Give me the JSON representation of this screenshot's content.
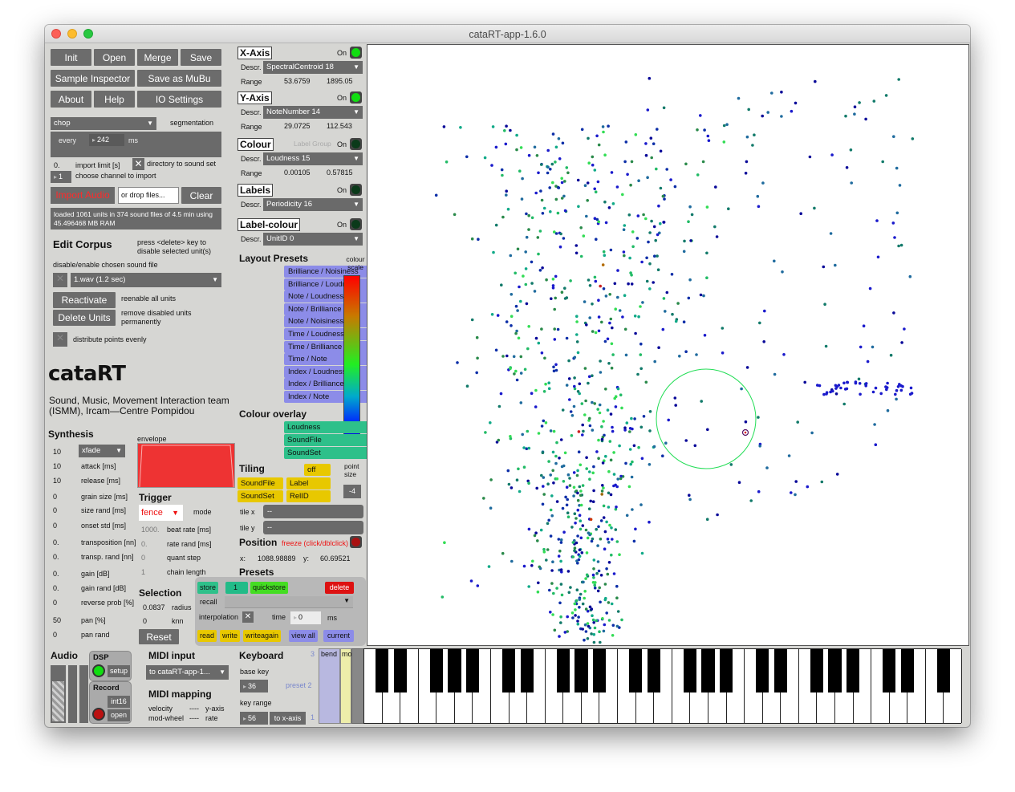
{
  "window": {
    "title": "cataRT-app-1.6.0"
  },
  "top_buttons": {
    "init": "Init",
    "open": "Open",
    "merge": "Merge",
    "save": "Save",
    "sample_inspector": "Sample Inspector",
    "save_mubu": "Save as MuBu",
    "about": "About",
    "help": "Help",
    "io_settings": "IO Settings"
  },
  "segmentation": {
    "mode": "chop",
    "label": "segmentation",
    "every_label": "every",
    "every_value": "242",
    "unit": "ms"
  },
  "import": {
    "limit_value": "0.",
    "limit_label": "import limit [s]",
    "dir_label": "directory to sound set",
    "channel_value": "1",
    "channel_label": "choose channel to import",
    "import_audio": "Import Audio",
    "drop_placeholder": "or drop files...",
    "clear": "Clear",
    "status": "loaded 1061 units in 374 sound files of 4.5 min using 45.496468 MB RAM"
  },
  "edit_corpus": {
    "title": "Edit Corpus",
    "hint": "press <delete> key  to disable selected unit(s)",
    "disable_label": "disable/enable chosen sound file",
    "file": "1.wav (1.2 sec)",
    "reactivate": "Reactivate",
    "reenable": "reenable all units",
    "delete_units": "Delete Units",
    "remove_label": "remove disabled units permanently",
    "distribute": "distribute points evenly"
  },
  "brand": {
    "name": "cataRT",
    "subtitle": "Sound, Music, Movement Interaction team (ISMM), Ircam—Centre Pompidou"
  },
  "synthesis": {
    "title": "Synthesis",
    "mode": "xfade",
    "envelope_label": "envelope",
    "params": [
      {
        "v": "10",
        "l": "attack [ms]"
      },
      {
        "v": "10",
        "l": "release [ms]"
      },
      {
        "v": "0",
        "l": "grain size [ms]"
      },
      {
        "v": "0",
        "l": "size rand [ms]"
      },
      {
        "v": "0",
        "l": "onset std [ms]"
      },
      {
        "v": "0.",
        "l": "transposition [nn]"
      },
      {
        "v": "0.",
        "l": "transp. rand [nn]"
      },
      {
        "v": "0.",
        "l": "gain [dB]"
      },
      {
        "v": "0.",
        "l": "gain rand [dB]"
      },
      {
        "v": "0",
        "l": "reverse prob [%]"
      },
      {
        "v": "50",
        "l": "pan [%]"
      },
      {
        "v": "0",
        "l": "pan rand"
      }
    ],
    "top_value": "10"
  },
  "trigger": {
    "title": "Trigger",
    "mode": "fence",
    "mode_label": "mode",
    "beat_rate_v": "1000.",
    "beat_rate_l": "beat rate [ms]",
    "rate_rand_v": "0.",
    "rate_rand_l": "rate rand [ms]",
    "quant_v": "0",
    "quant_l": "quant step",
    "chain_v": "1",
    "chain_l": "chain length"
  },
  "selection": {
    "title": "Selection",
    "radius_v": "0.0837",
    "radius_l": "radius",
    "knn_v": "0",
    "knn_l": "knn",
    "reset": "Reset"
  },
  "axes": {
    "x": {
      "title": "X-Axis",
      "on": "On",
      "descr_label": "Descr.",
      "descr": "SpectralCentroid 18",
      "range_label": "Range",
      "min": "53.6759",
      "max": "1895.05"
    },
    "y": {
      "title": "Y-Axis",
      "on": "On",
      "descr_label": "Descr.",
      "descr": "NoteNumber 14",
      "range_label": "Range",
      "min": "29.0725",
      "max": "112.543"
    },
    "colour": {
      "title": "Colour",
      "label_group": "Label Group",
      "on": "On",
      "descr_label": "Descr.",
      "descr": "Loudness 15",
      "range_label": "Range",
      "min": "0.00105",
      "max": "0.57815"
    },
    "labels": {
      "title": "Labels",
      "on": "On",
      "descr_label": "Descr.",
      "descr": "Periodicity 16"
    },
    "label_colour": {
      "title": "Label-colour",
      "on": "On",
      "descr_label": "Descr.",
      "descr": "UnitID 0"
    }
  },
  "layout_presets": {
    "title": "Layout Presets",
    "items": [
      "Brilliance / Noisiness",
      "Brilliance / Loudness",
      "Note / Loudness",
      "Note / Brilliance",
      "Note / Noisiness",
      "Time / Loudness",
      "Time / Brilliance",
      "Time / Note",
      "Index / Loudness",
      "Index / Brilliance",
      "Index / Note"
    ]
  },
  "colour_scale": {
    "label": "colour scale"
  },
  "colour_overlay": {
    "title": "Colour overlay",
    "items": [
      "Loudness",
      "SoundFile",
      "SoundSet"
    ]
  },
  "tiling": {
    "title": "Tiling",
    "off": "off",
    "soundfile": "SoundFile",
    "label": "Label",
    "soundset": "SoundSet",
    "relid": "RelID",
    "tile_x": "tile x",
    "tile_y": "tile y",
    "tile_x_v": "--",
    "tile_y_v": "--",
    "point_size_label": "point size",
    "point_size": "-4"
  },
  "position": {
    "title": "Position",
    "freeze": "freeze (click/dblclick)",
    "x_label": "x:",
    "x": "1088.98889",
    "y_label": "y:",
    "y": "60.69521"
  },
  "presets": {
    "title": "Presets",
    "store": "store",
    "num": "1",
    "quickstore": "quickstore",
    "delete": "delete",
    "recall": "recall",
    "interpolation": "interpolation",
    "time": "time",
    "time_v": "0",
    "ms": "ms",
    "read": "read",
    "write": "write",
    "writeagain": "writeagain",
    "view_all": "view all",
    "current": "current"
  },
  "audio": {
    "title": "Audio",
    "dsp": "DSP",
    "setup": "setup",
    "record": "Record",
    "int16": "int16",
    "open": "open"
  },
  "midi": {
    "input_title": "MIDI input",
    "input": "to cataRT-app-1...",
    "mapping_title": "MIDI mapping",
    "velocity": "velocity",
    "vel_dash": "----",
    "y_axis": "y-axis",
    "modwheel": "mod-wheel",
    "mod_dash": "----",
    "rate": "rate"
  },
  "keyboard": {
    "title": "Keyboard",
    "base_key_label": "base key",
    "base_key": "36",
    "preset": "preset 2",
    "key_range_label": "key range",
    "key_range": "56",
    "to_x": "to x-axis",
    "n3": "3",
    "n1": "1",
    "bend": "bend",
    "mod": "mod"
  },
  "colors": {
    "accent_green": "#11dd11",
    "import_red": "#ee1111",
    "preset_blue": "#8c8ce8",
    "overlay_green": "#2ec08a",
    "tiling_yellow": "#e8c800",
    "envelope_red": "#ee3333"
  },
  "plot": {
    "selection_circle": "visible",
    "cursor": "visible"
  }
}
